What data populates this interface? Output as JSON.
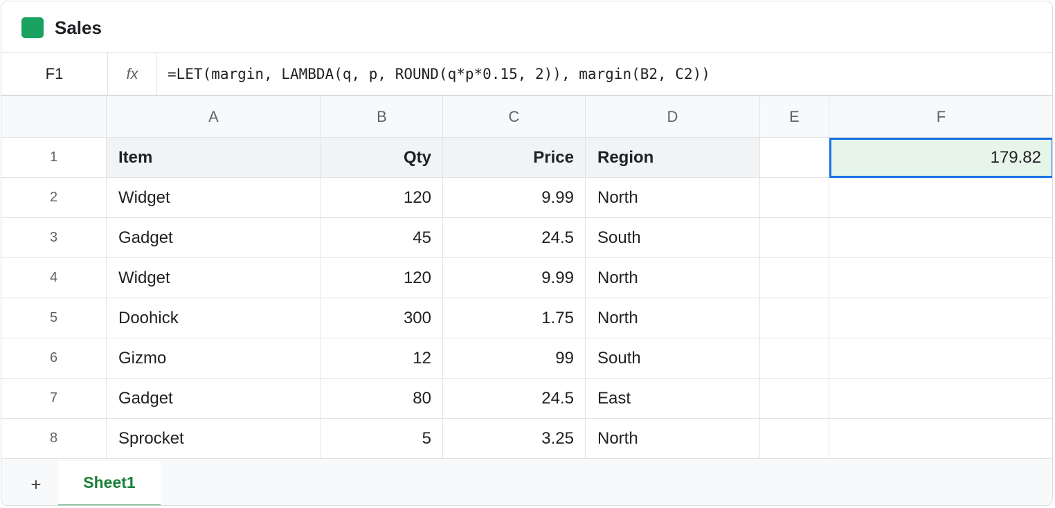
{
  "app": {
    "title": "Sales",
    "logo_icon": "spreadsheet-logo-icon",
    "accent_color": "#1aa260"
  },
  "formula_bar": {
    "cell_ref": "F1",
    "fx_label": "fx",
    "formula": "=LET(margin, LAMBDA(q, p, ROUND(q*p*0.15, 2)), margin(B2, C2))"
  },
  "grid": {
    "columns": [
      "A",
      "B",
      "C",
      "D",
      "E",
      "F"
    ],
    "rows": [
      {
        "num": "1",
        "cells": [
          "Item",
          "Qty",
          "Price",
          "Region",
          "",
          "179.82"
        ]
      },
      {
        "num": "2",
        "cells": [
          "Widget",
          "120",
          "9.99",
          "North",
          "",
          ""
        ]
      },
      {
        "num": "3",
        "cells": [
          "Gadget",
          "45",
          "24.5",
          "South",
          "",
          ""
        ]
      },
      {
        "num": "4",
        "cells": [
          "Widget",
          "120",
          "9.99",
          "North",
          "",
          ""
        ]
      },
      {
        "num": "5",
        "cells": [
          "Doohick",
          "300",
          "1.75",
          "North",
          "",
          ""
        ]
      },
      {
        "num": "6",
        "cells": [
          "Gizmo",
          "12",
          "99",
          "South",
          "",
          ""
        ]
      },
      {
        "num": "7",
        "cells": [
          "Gadget",
          "80",
          "24.5",
          "East",
          "",
          ""
        ]
      },
      {
        "num": "8",
        "cells": [
          "Sprocket",
          "5",
          "3.25",
          "North",
          "",
          ""
        ]
      }
    ],
    "selected_cell": "F1"
  },
  "sheet_tabs": {
    "add_label": "+",
    "tabs": [
      "Sheet1"
    ],
    "active_color": "#188038"
  }
}
